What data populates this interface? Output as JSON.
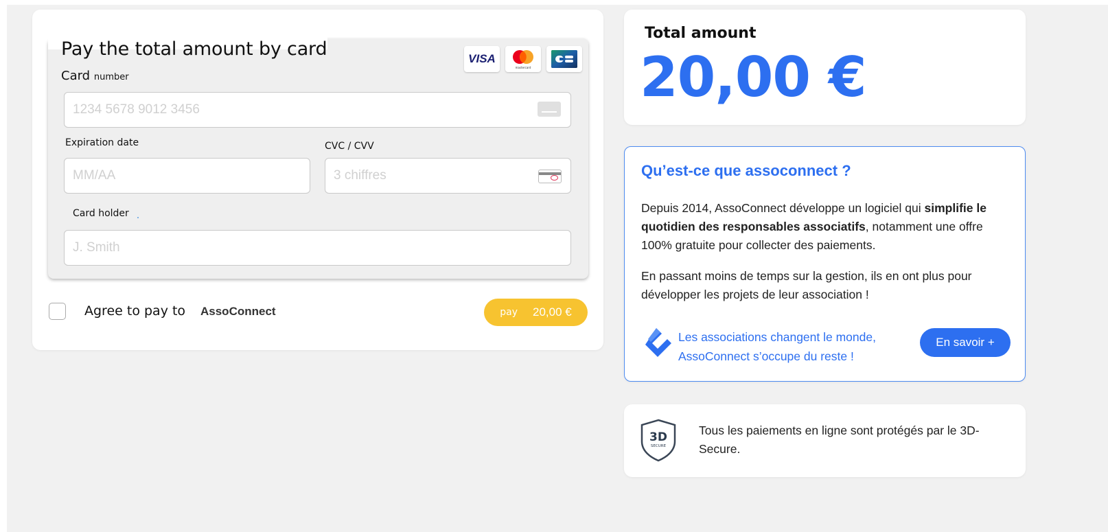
{
  "payment": {
    "title": "Pay the total amount by card",
    "card_label": "Card",
    "card_label_small": "number",
    "card_placeholder": "1234 5678 9012 3456",
    "expiration_label": "Expiration date",
    "expiration_placeholder": "MM/AA",
    "cvc_label": "CVC / CVV",
    "cvc_placeholder": "3 chiffres",
    "holder_label": "Card holder",
    "holder_placeholder": "J. Smith",
    "brands": [
      "VISA",
      "mastercard",
      "CB"
    ],
    "agree_text": "Agree to pay to",
    "agree_org": "AssoConnect",
    "pay_word": "pay",
    "pay_amount": "20,00 €"
  },
  "total": {
    "label": "Total amount",
    "value": "20,00 €"
  },
  "info": {
    "title": "Qu’est-ce que assoconnect ?",
    "p1_before": "Depuis 2014, AssoConnect développe un logiciel qui ",
    "p1_bold": "simplifie le quotidien des responsables associatifs",
    "p1_after": ", notamment une offre 100% gratuite pour collecter des paiements.",
    "p2": "En passant moins de temps sur la gestion, ils en ont plus pour développer les projets de leur association !",
    "tagline_line1": "Les associations changent le monde,",
    "tagline_line2": "AssoConnect s’occupe du reste !",
    "button": "En savoir +"
  },
  "secure": {
    "badge_main": "3D",
    "badge_sub": "SECURE",
    "text": "Tous les paiements en ligne sont protégés par le 3D-Secure."
  },
  "colors": {
    "accent_blue": "#2d6ff0",
    "pay_yellow": "#f7c330",
    "background": "#f1f1f1"
  }
}
